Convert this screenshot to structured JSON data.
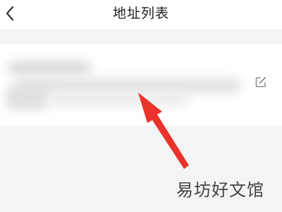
{
  "navbar": {
    "title": "地址列表",
    "back_icon": "chevron-left-icon"
  },
  "address_list": {
    "items": [
      {
        "redacted": true,
        "edit_icon": "edit-icon"
      }
    ]
  },
  "annotation": {
    "arrow_color": "#e8322a"
  },
  "watermark": {
    "text": "易坊好文馆"
  },
  "colors": {
    "page_background": "#f4f4f4",
    "card_background": "#ffffff",
    "title_text": "#222222",
    "icon_gray": "#8a8a8a"
  }
}
